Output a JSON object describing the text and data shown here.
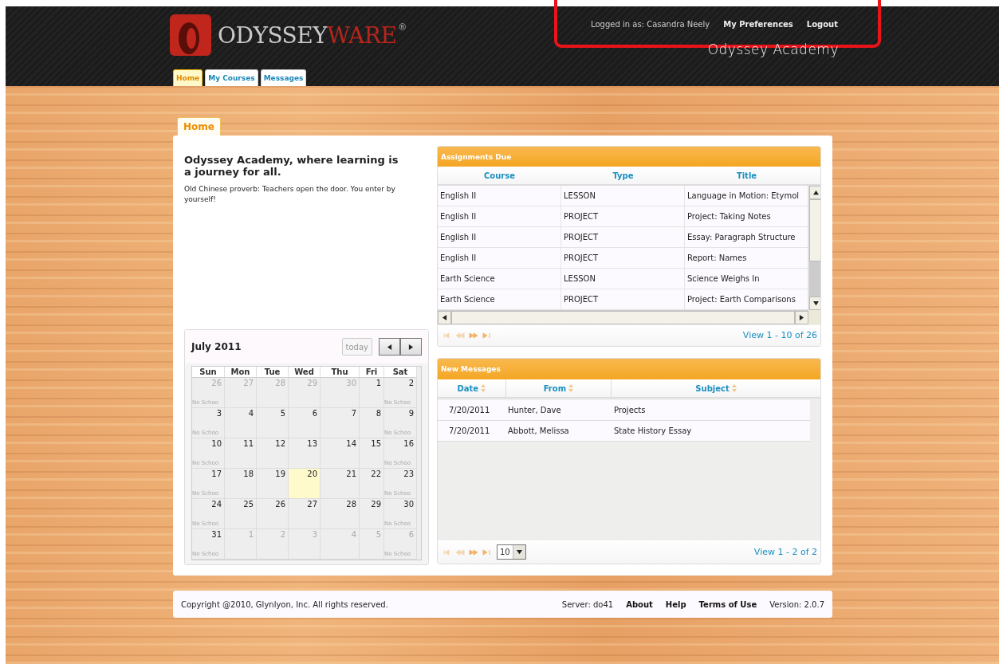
{
  "header": {
    "logo": {
      "part_1": "ODYSSEY",
      "part_2": "WARE",
      "mark": "®"
    },
    "user_bar": {
      "logged_in": "Logged in as: Casandra Neely",
      "links": [
        "My Preferences",
        "Logout"
      ]
    },
    "school": "Odyssey Academy"
  },
  "nav_tabs": [
    {
      "label": "Home",
      "selected": true
    },
    {
      "label": "My Courses",
      "selected": false
    },
    {
      "label": "Messages",
      "selected": false
    }
  ],
  "page_tab": {
    "label": "Home"
  },
  "welcome": {
    "title": "Odyssey Academy, where learning is a journey for all.",
    "text": "Old Chinese proverb: Teachers open the door. You enter by yourself!"
  },
  "calendar": {
    "title": "July 2011",
    "today_button": "today",
    "weekdays": [
      "Sun",
      "Mon",
      "Tue",
      "Wed",
      "Thu",
      "Fri",
      "Sat"
    ],
    "weeks": [
      [
        {
          "day": "26",
          "other_month": true,
          "today": false,
          "note": "No Schoo"
        },
        {
          "day": "27",
          "other_month": true,
          "today": false
        },
        {
          "day": "28",
          "other_month": true,
          "today": false
        },
        {
          "day": "29",
          "other_month": true,
          "today": false
        },
        {
          "day": "30",
          "other_month": true,
          "today": false
        },
        {
          "day": "1",
          "other_month": false,
          "today": false
        },
        {
          "day": "2",
          "other_month": false,
          "today": false,
          "note": "No Schoo"
        }
      ],
      [
        {
          "day": "3",
          "other_month": false,
          "today": false,
          "note": "No Schoo"
        },
        {
          "day": "4",
          "other_month": false,
          "today": false
        },
        {
          "day": "5",
          "other_month": false,
          "today": false
        },
        {
          "day": "6",
          "other_month": false,
          "today": false
        },
        {
          "day": "7",
          "other_month": false,
          "today": false
        },
        {
          "day": "8",
          "other_month": false,
          "today": false
        },
        {
          "day": "9",
          "other_month": false,
          "today": false,
          "note": "No Schoo"
        }
      ],
      [
        {
          "day": "10",
          "other_month": false,
          "today": false,
          "note": "No Schoo"
        },
        {
          "day": "11",
          "other_month": false,
          "today": false
        },
        {
          "day": "12",
          "other_month": false,
          "today": false
        },
        {
          "day": "13",
          "other_month": false,
          "today": false
        },
        {
          "day": "14",
          "other_month": false,
          "today": false
        },
        {
          "day": "15",
          "other_month": false,
          "today": false
        },
        {
          "day": "16",
          "other_month": false,
          "today": false,
          "note": "No Schoo"
        }
      ],
      [
        {
          "day": "17",
          "other_month": false,
          "today": false,
          "note": "No Schoo"
        },
        {
          "day": "18",
          "other_month": false,
          "today": false
        },
        {
          "day": "19",
          "other_month": false,
          "today": false
        },
        {
          "day": "20",
          "other_month": false,
          "today": true
        },
        {
          "day": "21",
          "other_month": false,
          "today": false
        },
        {
          "day": "22",
          "other_month": false,
          "today": false
        },
        {
          "day": "23",
          "other_month": false,
          "today": false,
          "note": "No Schoo"
        }
      ],
      [
        {
          "day": "24",
          "other_month": false,
          "today": false,
          "note": "No Schoo"
        },
        {
          "day": "25",
          "other_month": false,
          "today": false
        },
        {
          "day": "26",
          "other_month": false,
          "today": false
        },
        {
          "day": "27",
          "other_month": false,
          "today": false
        },
        {
          "day": "28",
          "other_month": false,
          "today": false
        },
        {
          "day": "29",
          "other_month": false,
          "today": false
        },
        {
          "day": "30",
          "other_month": false,
          "today": false,
          "note": "No Schoo"
        }
      ],
      [
        {
          "day": "31",
          "other_month": false,
          "today": false,
          "note": "No Schoo"
        },
        {
          "day": "1",
          "other_month": true,
          "today": false
        },
        {
          "day": "2",
          "other_month": true,
          "today": false
        },
        {
          "day": "3",
          "other_month": true,
          "today": false
        },
        {
          "day": "4",
          "other_month": true,
          "today": false
        },
        {
          "day": "5",
          "other_month": true,
          "today": false
        },
        {
          "day": "6",
          "other_month": true,
          "today": false,
          "note": "No Schoo"
        }
      ]
    ]
  },
  "assignments": {
    "title": "Assignments Due",
    "columns": [
      "Course",
      "Type",
      "Title"
    ],
    "rows": [
      [
        "English II",
        "LESSON",
        "Language in Motion: Etymol"
      ],
      [
        "English II",
        "PROJECT",
        "Project: Taking Notes"
      ],
      [
        "English II",
        "PROJECT",
        "Essay: Paragraph Structure"
      ],
      [
        "English II",
        "PROJECT",
        "Report: Names"
      ],
      [
        "Earth Science",
        "LESSON",
        "Science Weighs In"
      ],
      [
        "Earth Science",
        "PROJECT",
        "Project: Earth Comparisons"
      ]
    ],
    "pager": "View 1 - 10 of 26"
  },
  "messages": {
    "title": "New Messages",
    "columns": [
      "Date",
      "From",
      "Subject"
    ],
    "rows": [
      [
        "7/20/2011",
        "Hunter, Dave",
        "Projects"
      ],
      [
        "7/20/2011",
        "Abbott, Melissa",
        "State History Essay"
      ]
    ],
    "page_size": "10",
    "pager": "View 1 - 2 of 2"
  },
  "footer": {
    "copyright": "Copyright @2010, Glynlyon, Inc. All rights reserved.",
    "server": "Server: do41",
    "links": [
      "About",
      "Help",
      "Terms of Use"
    ],
    "version": "Version: 2.0.7"
  }
}
